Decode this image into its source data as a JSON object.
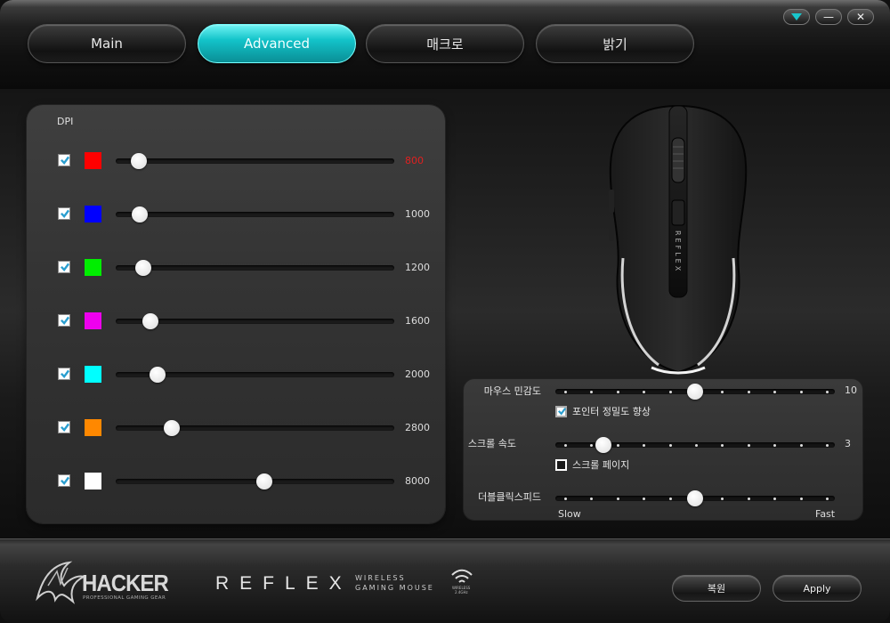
{
  "tabs": [
    {
      "label": "Main",
      "active": false
    },
    {
      "label": "Advanced",
      "active": true
    },
    {
      "label": "매크로",
      "active": false
    },
    {
      "label": "밝기",
      "active": false
    }
  ],
  "window_controls": {
    "dropdown_icon": "triangle-down-icon",
    "minimize_icon": "minimize-icon",
    "close_icon": "close-icon",
    "minimize_glyph": "—",
    "close_glyph": "✕"
  },
  "dpi": {
    "title": "DPI",
    "levels": [
      {
        "color": "#ff0000",
        "value": "800",
        "value_color": "#e02020",
        "checked": true,
        "position": 0.082
      },
      {
        "color": "#0000ff",
        "value": "1000",
        "value_color": "#dddddd",
        "checked": true,
        "position": 0.085
      },
      {
        "color": "#00ee00",
        "value": "1200",
        "value_color": "#dddddd",
        "checked": true,
        "position": 0.098
      },
      {
        "color": "#ee00ee",
        "value": "1600",
        "value_color": "#dddddd",
        "checked": true,
        "position": 0.124
      },
      {
        "color": "#00ffff",
        "value": "2000",
        "value_color": "#dddddd",
        "checked": true,
        "position": 0.15
      },
      {
        "color": "#ff8800",
        "value": "2800",
        "value_color": "#dddddd",
        "checked": true,
        "position": 0.202
      },
      {
        "color": "#ffffff",
        "value": "8000",
        "value_color": "#dddddd",
        "checked": true,
        "position": 0.534
      }
    ]
  },
  "mouse_image": {
    "brand_text": "REFLEX"
  },
  "settings": {
    "sensitivity": {
      "label": "마우스 민감도",
      "value": "10",
      "level": 10,
      "max": 20
    },
    "enhance_precision": {
      "label": "포인터 정밀도 향상",
      "checked": true
    },
    "scroll_speed": {
      "label": "스크롤 속도",
      "value": "3",
      "level": 3,
      "max": 20
    },
    "scroll_page": {
      "label": "스크롤 페이지",
      "checked": false
    },
    "double_click": {
      "label": "더블클릭스피드",
      "level": 5,
      "max": 10,
      "min_label": "Slow",
      "max_label": "Fast"
    }
  },
  "footer": {
    "logo_text": "HACKER",
    "logo_subtext": "PROFESSIONAL GAMING GEAR",
    "product_name": "REFLEX",
    "product_line1": "WIRELESS",
    "product_line2": "GAMING MOUSE",
    "wireless_badge_line1": "WIRELESS",
    "wireless_badge_line2": "2.4GHz",
    "reset_label": "복원",
    "apply_label": "Apply"
  },
  "accent_color": "#13c3c9"
}
